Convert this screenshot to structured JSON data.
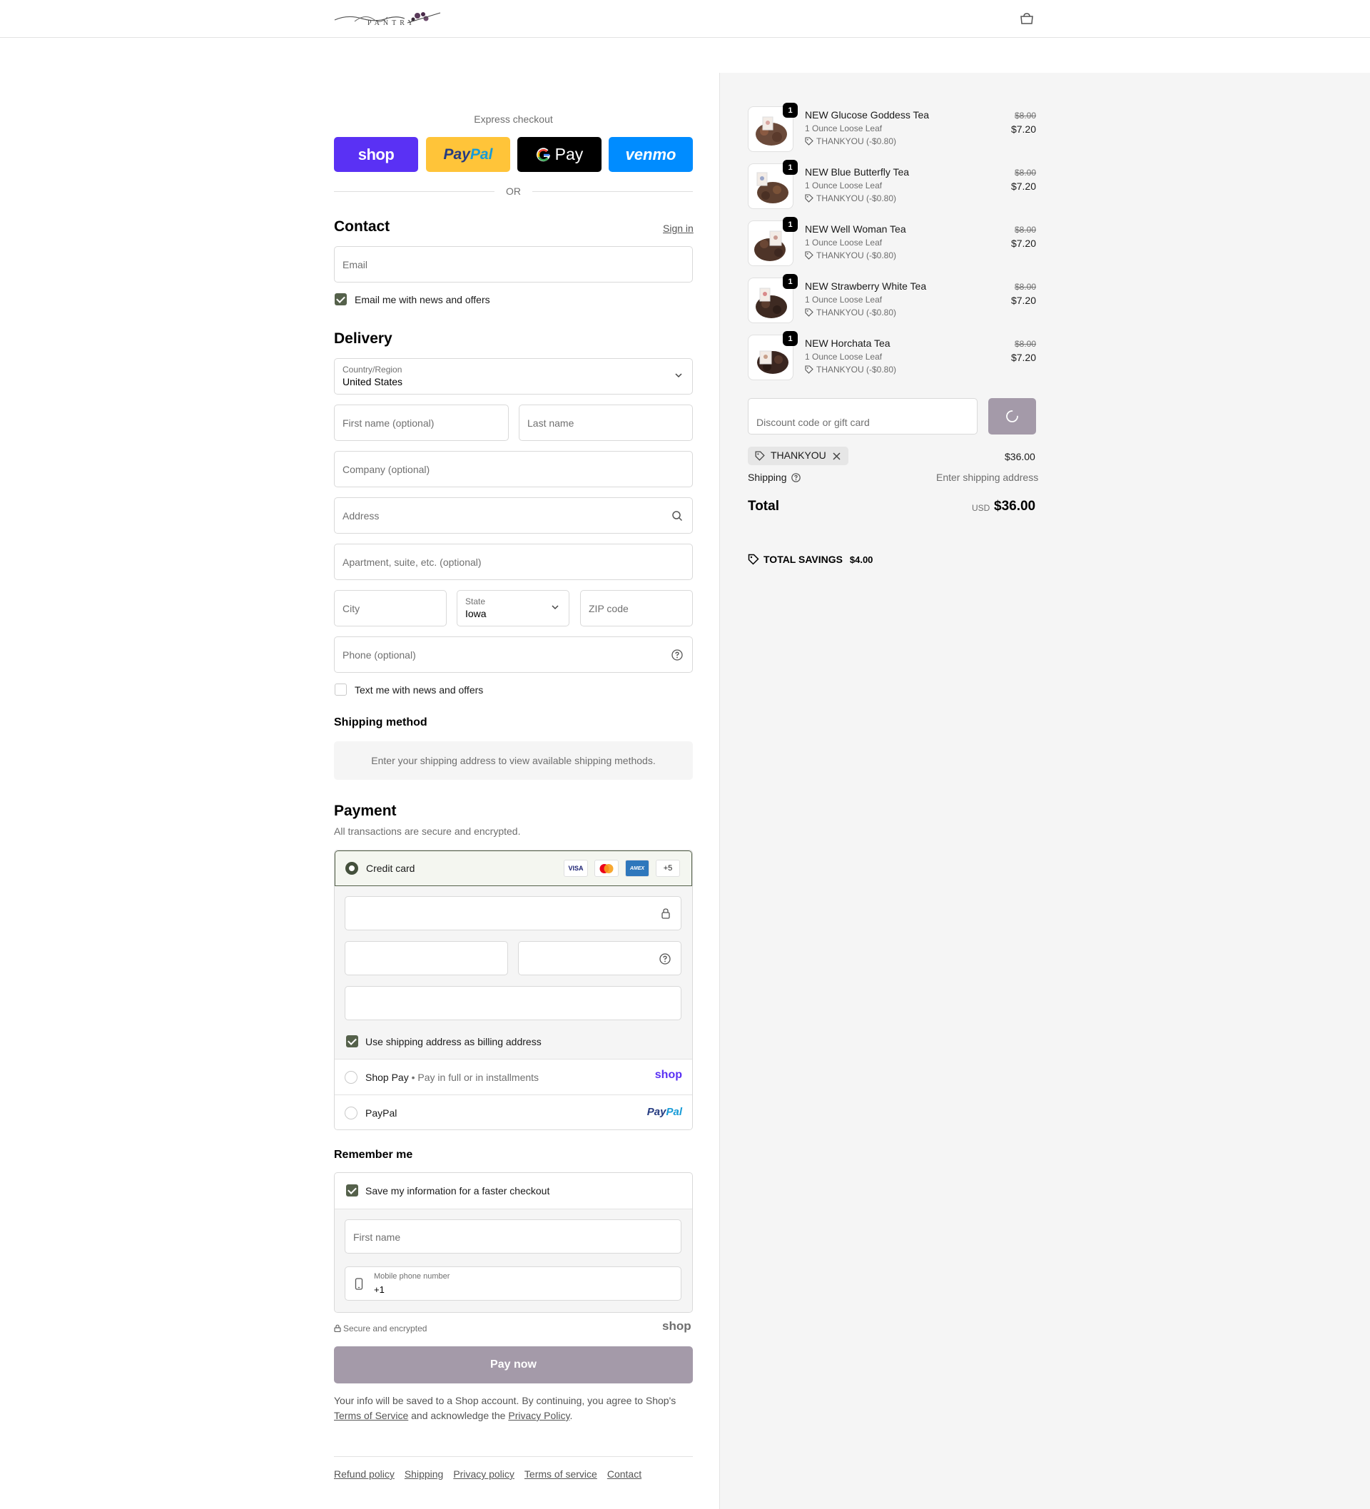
{
  "header": {
    "logo_text": "PANTRY",
    "cart_icon": "bag-icon"
  },
  "express": {
    "label": "Express checkout",
    "buttons": {
      "shop": "shop",
      "paypal_a": "Pay",
      "paypal_b": "Pal",
      "gpay": "Pay",
      "venmo": "venmo"
    },
    "or": "OR"
  },
  "contact": {
    "title": "Contact",
    "sign_in": "Sign in",
    "email_placeholder": "Email",
    "news_label": "Email me with news and offers",
    "news_checked": true
  },
  "delivery": {
    "title": "Delivery",
    "country_label": "Country/Region",
    "country_value": "United States",
    "first_name_placeholder": "First name (optional)",
    "last_name_placeholder": "Last name",
    "company_placeholder": "Company (optional)",
    "address_placeholder": "Address",
    "apartment_placeholder": "Apartment, suite, etc. (optional)",
    "city_placeholder": "City",
    "state_label": "State",
    "state_value": "Iowa",
    "zip_placeholder": "ZIP code",
    "phone_placeholder": "Phone (optional)",
    "text_news_label": "Text me with news and offers",
    "text_news_checked": false
  },
  "shipping_method": {
    "title": "Shipping method",
    "message": "Enter your shipping address to view available shipping methods."
  },
  "payment": {
    "title": "Payment",
    "subtitle": "All transactions are secure and encrypted.",
    "credit_card_label": "Credit card",
    "card_brands": [
      "VISA",
      "Mastercard",
      "AMEX"
    ],
    "more_cards": "+5",
    "billing_same_label": "Use shipping address as billing address",
    "billing_same_checked": true,
    "shop_pay_label": "Shop Pay",
    "shop_pay_desc": "Pay in full or in installments",
    "shop_pay_logo": "shop",
    "paypal_label": "PayPal",
    "paypal_logo_a": "Pay",
    "paypal_logo_b": "Pal"
  },
  "remember_me": {
    "title": "Remember me",
    "save_label": "Save my information for a faster checkout",
    "save_checked": true,
    "first_name_placeholder": "First name",
    "phone_label": "Mobile phone number",
    "phone_value": "+1"
  },
  "secure_text": "Secure and encrypted",
  "shop_logo": "shop",
  "pay_now": "Pay now",
  "legal": {
    "text_1": "Your info will be saved to a Shop account. By continuing, you agree to Shop's",
    "terms": "Terms of Service",
    "text_2": "and acknowledge the",
    "privacy": "Privacy Policy",
    "text_3": "."
  },
  "footer_links": [
    "Refund policy",
    "Shipping",
    "Privacy policy",
    "Terms of service",
    "Contact"
  ],
  "summary": {
    "items": [
      {
        "qty": "1",
        "name": "NEW Glucose Goddess Tea",
        "variant": "1 Ounce Loose Leaf",
        "discount": "THANKYOU (-$0.80)",
        "old_price": "$8.00",
        "price": "$7.20"
      },
      {
        "qty": "1",
        "name": "NEW Blue Butterfly Tea",
        "variant": "1 Ounce Loose Leaf",
        "discount": "THANKYOU (-$0.80)",
        "old_price": "$8.00",
        "price": "$7.20"
      },
      {
        "qty": "1",
        "name": "NEW Well Woman Tea",
        "variant": "1 Ounce Loose Leaf",
        "discount": "THANKYOU (-$0.80)",
        "old_price": "$8.00",
        "price": "$7.20"
      },
      {
        "qty": "1",
        "name": "NEW Strawberry White Tea",
        "variant": "1 Ounce Loose Leaf",
        "discount": "THANKYOU (-$0.80)",
        "old_price": "$8.00",
        "price": "$7.20"
      },
      {
        "qty": "1",
        "name": "NEW Horchata Tea",
        "variant": "1 Ounce Loose Leaf",
        "discount": "THANKYOU (-$0.80)",
        "old_price": "$8.00",
        "price": "$7.20"
      }
    ],
    "discount_placeholder": "Discount code or gift card",
    "applied_code": "THANKYOU",
    "subtotal": "$36.00",
    "shipping_label": "Shipping",
    "shipping_value": "Enter shipping address",
    "total_label": "Total",
    "currency": "USD",
    "total": "$36.00",
    "savings_label": "TOTAL SAVINGS",
    "savings_value": "$4.00"
  },
  "colors": {
    "accent": "#55614b",
    "button_muted": "#a49aa9",
    "shop_purple": "#5a31f4",
    "venmo_blue": "#008cff",
    "paypal_yellow": "#ffc439"
  }
}
